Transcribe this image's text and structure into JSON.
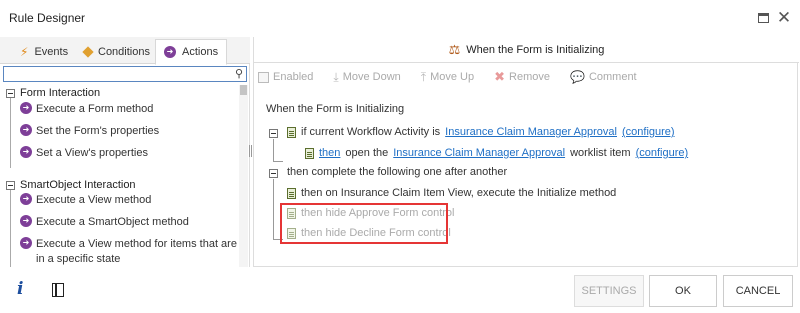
{
  "window": {
    "title": "Rule Designer"
  },
  "left_panel": {
    "tabs": [
      {
        "label": "Events",
        "icon": "lightning-icon"
      },
      {
        "label": "Conditions",
        "icon": "diamond-icon"
      },
      {
        "label": "Actions",
        "icon": "arrow-circle-icon",
        "active": true
      }
    ],
    "search": {
      "value": "",
      "placeholder": ""
    },
    "groups": [
      {
        "label": "Form Interaction",
        "items": [
          "Execute a Form method",
          "Set the Form's properties",
          "Set a View's properties"
        ]
      },
      {
        "label": "SmartObject Interaction",
        "items": [
          "Execute a View method",
          "Execute a SmartObject method",
          "Execute a View method for items that are in a specific state"
        ]
      }
    ]
  },
  "right_panel": {
    "header": "When the Form is Initializing",
    "toolbar": {
      "enabled": "Enabled",
      "move_down": "Move Down",
      "move_up": "Move Up",
      "remove": "Remove",
      "comment": "Comment"
    },
    "rule": {
      "event": "When the Form is Initializing",
      "condition": {
        "prefix": "if current Workflow Activity is",
        "link1": "Insurance Claim Manager Approval",
        "link2": "(configure)"
      },
      "then_line": {
        "then_link": "then",
        "mid": "open the",
        "link1": "Insurance Claim Manager Approval",
        "mid2": "worklist item",
        "link2": "(configure)"
      },
      "sequence": "then complete the following one after another",
      "actions": [
        "then on Insurance Claim Item View, execute the Initialize method",
        "then hide Approve Form control",
        "then hide Decline Form control"
      ]
    }
  },
  "footer": {
    "settings": "SETTINGS",
    "ok": "OK",
    "cancel": "CANCEL"
  },
  "colors": {
    "link": "#1f6fc5",
    "highlight": "#e53535",
    "accent_purple": "#7e3f98"
  }
}
